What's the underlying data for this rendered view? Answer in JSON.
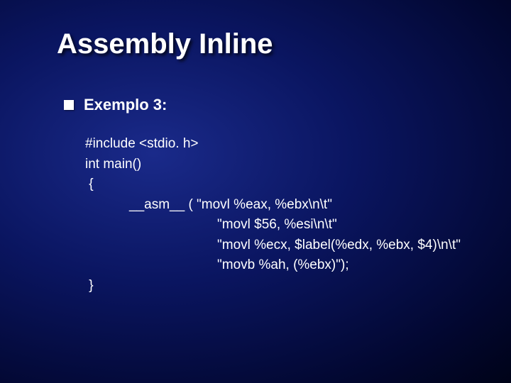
{
  "title": "Assembly Inline",
  "example_label": "Exemplo 3:",
  "code": {
    "l1": "#include <stdio. h>",
    "l2": "int main()",
    "l3": " {",
    "l4": "__asm__ ( \"movl %eax, %ebx\\n\\t\"",
    "l5": "\"movl $56, %esi\\n\\t\"",
    "l6": "\"movl %ecx, $label(%edx, %ebx, $4)\\n\\t\"",
    "l7": "\"movb %ah, (%ebx)\");",
    "l8": " }"
  }
}
